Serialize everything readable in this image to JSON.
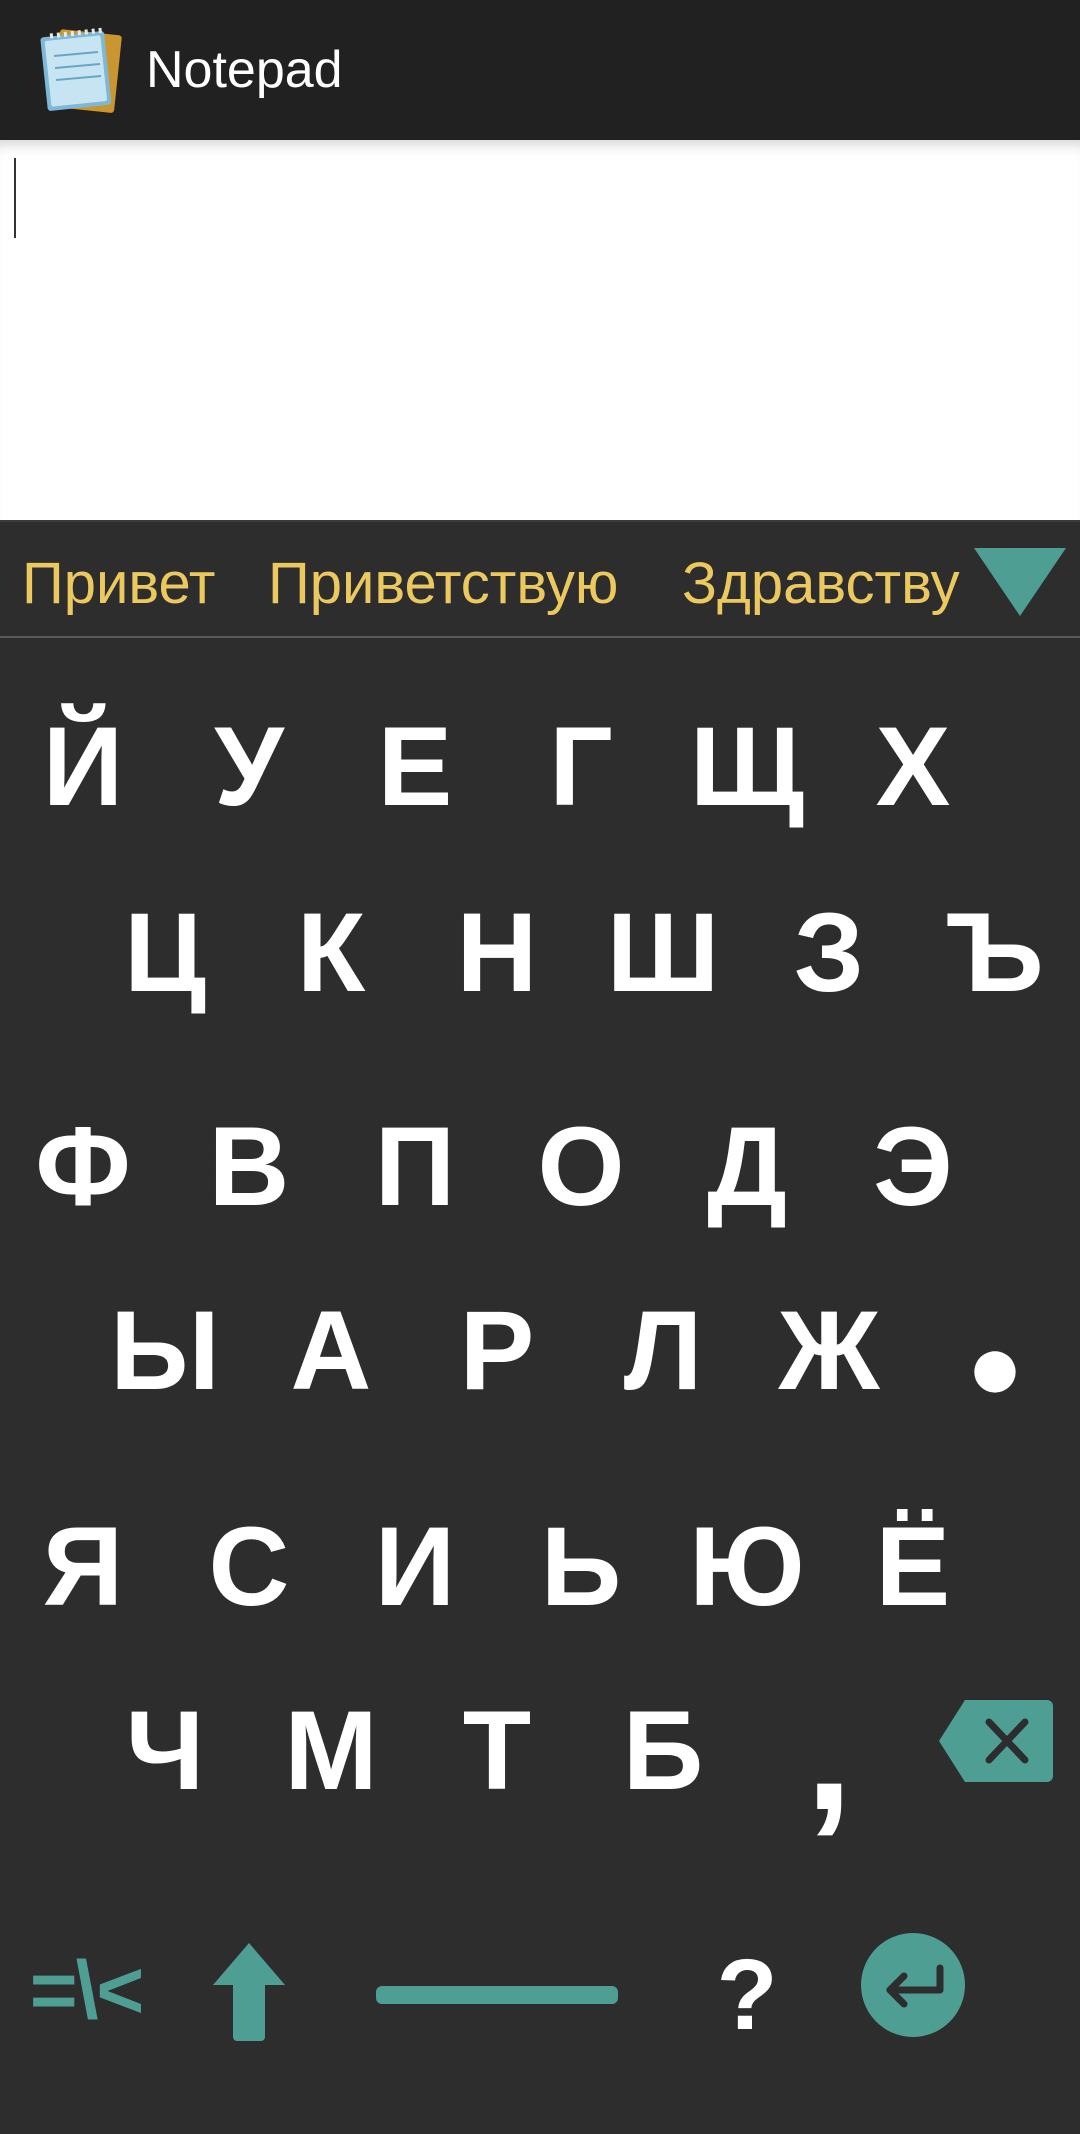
{
  "app": {
    "title": "Notepad",
    "icon": "notepad-icon"
  },
  "editor": {
    "text": ""
  },
  "suggestions": [
    "Привет",
    "Приветствую",
    "Здравствуйте"
  ],
  "colors": {
    "accent": "#4e9e93",
    "suggestion_text": "#ecc95f",
    "keyboard_bg": "#2d2d2d",
    "titlebar_bg": "#212121"
  },
  "keyboard": {
    "rows": [
      [
        "Й",
        "У",
        "Е",
        "Г",
        "Щ",
        "Х"
      ],
      [
        "Ц",
        "К",
        "Н",
        "Ш",
        "З",
        "Ъ"
      ],
      [
        "Ф",
        "В",
        "П",
        "О",
        "Д",
        "Э"
      ],
      [
        "Ы",
        "А",
        "Р",
        "Л",
        "Ж",
        "●"
      ],
      [
        "Я",
        "С",
        "И",
        "Ь",
        "Ю",
        "Ё"
      ],
      [
        "Ч",
        "М",
        "Т",
        "Б",
        ","
      ]
    ],
    "backspace_icon": "backspace-icon",
    "bottom_row": {
      "symbols_label": "=\\<",
      "shift_icon": "shift-arrow-up-icon",
      "space_icon": "space-bar-icon",
      "question_label": "?",
      "enter_icon": "enter-icon"
    }
  }
}
